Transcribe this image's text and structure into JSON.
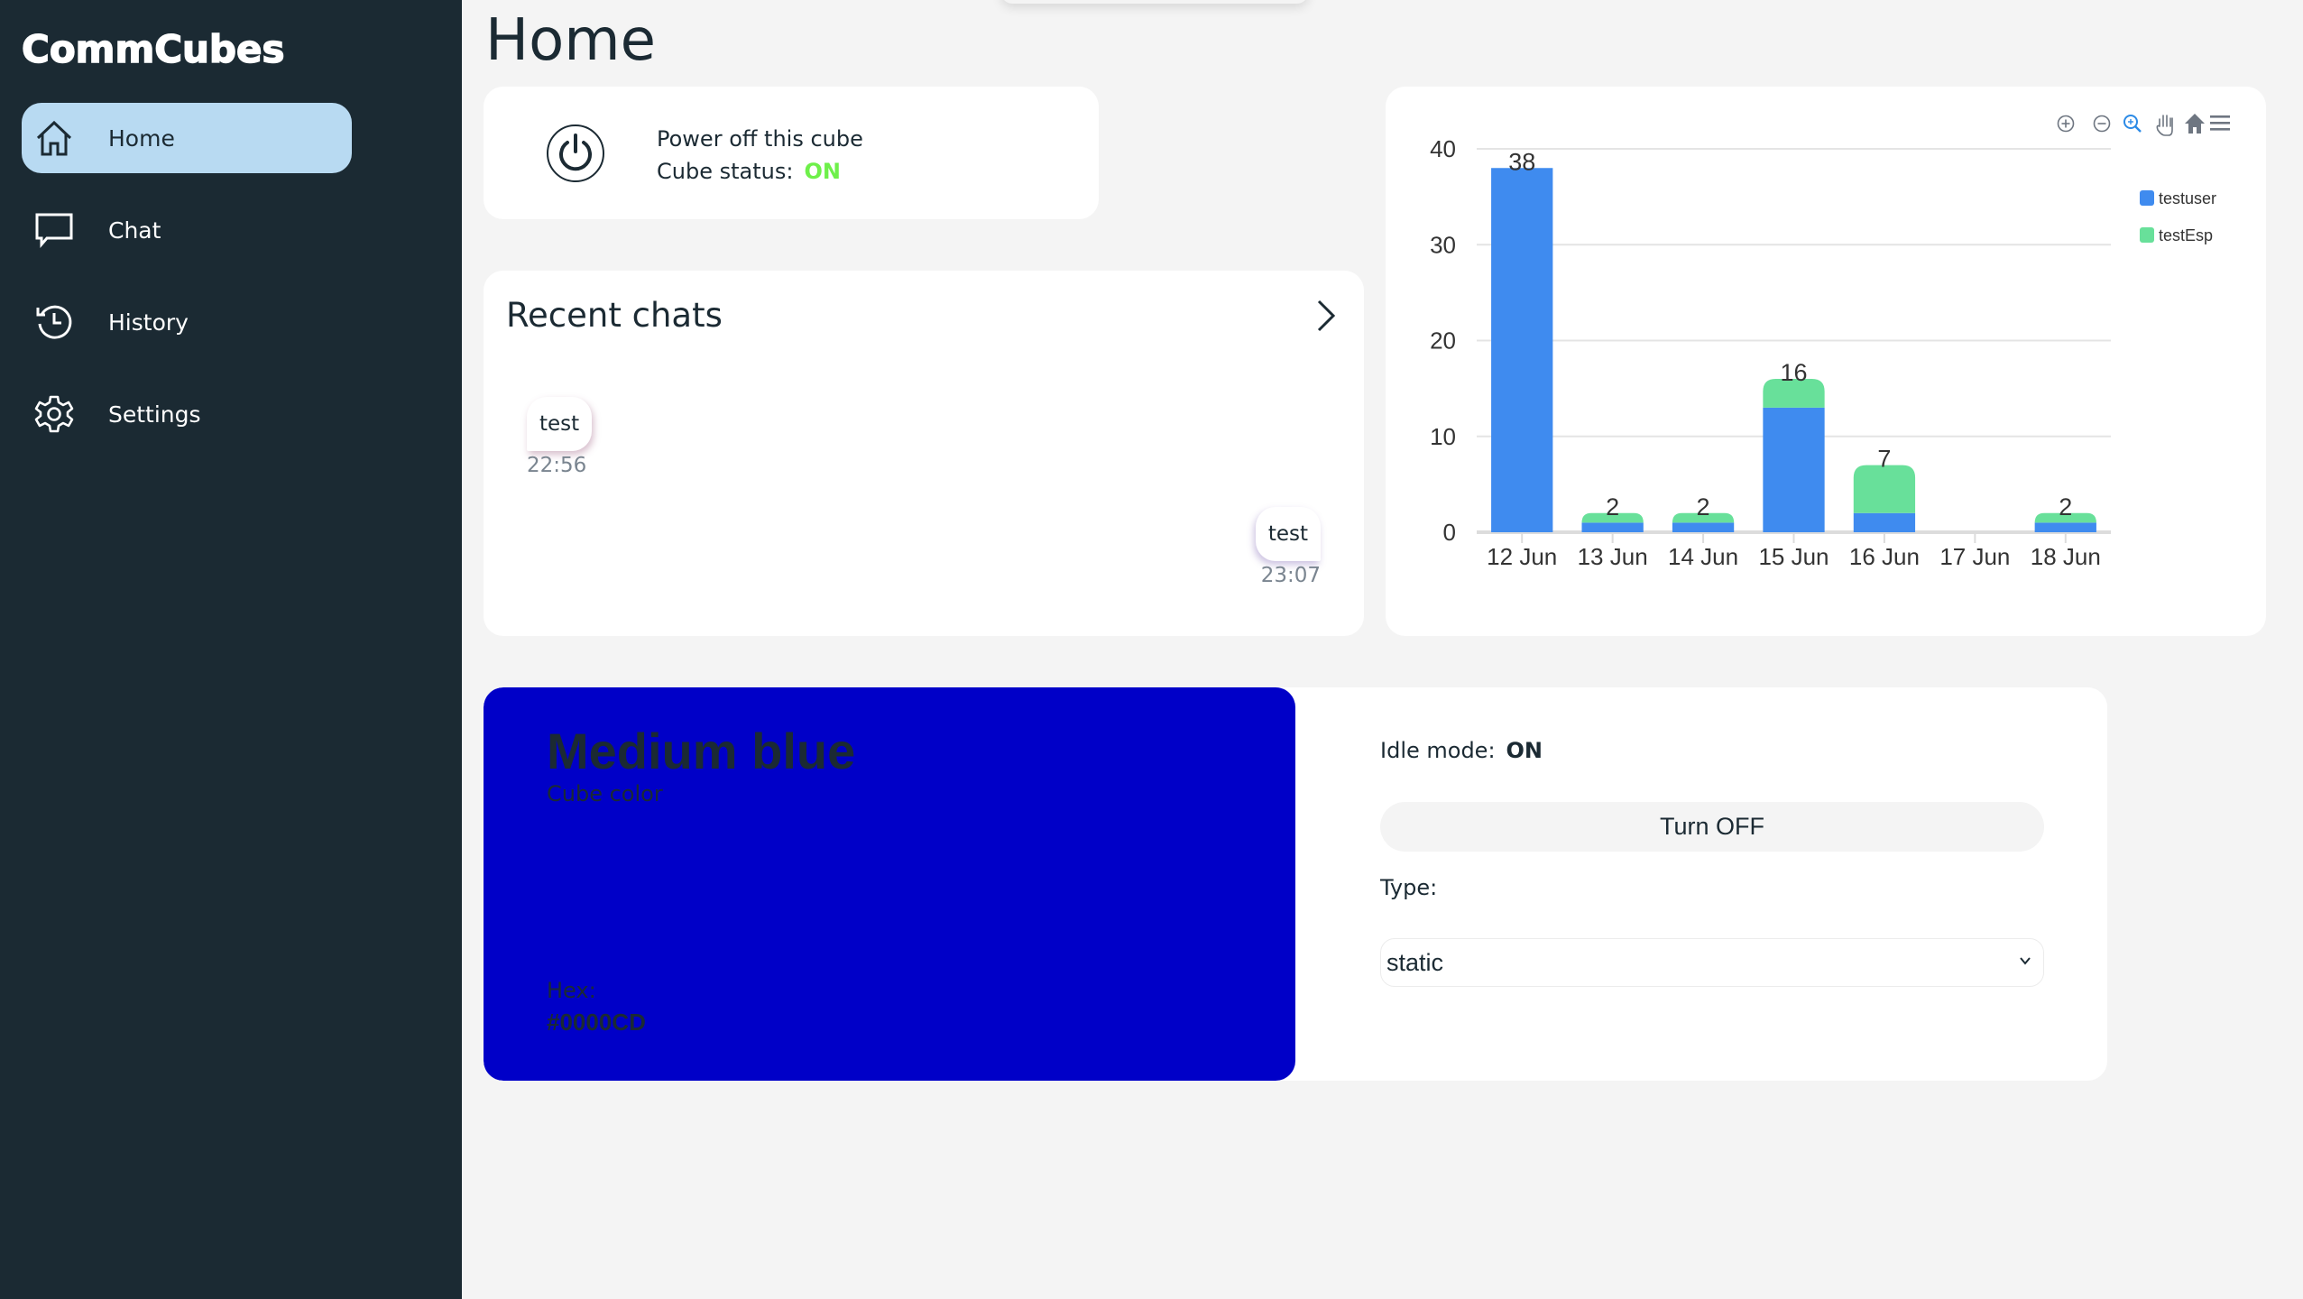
{
  "app": {
    "name": "CommCubes"
  },
  "sidebar": {
    "items": [
      {
        "label": "Home",
        "icon": "home-icon",
        "active": true
      },
      {
        "label": "Chat",
        "icon": "chat-icon",
        "active": false
      },
      {
        "label": "History",
        "icon": "history-icon",
        "active": false
      },
      {
        "label": "Settings",
        "icon": "gear-icon",
        "active": false
      }
    ]
  },
  "page": {
    "title": "Home"
  },
  "power_card": {
    "action_label": "Power off this cube",
    "status_label": "Cube status:",
    "status_value": "ON",
    "status_color": "#6ef04a"
  },
  "recent_chats": {
    "title": "Recent chats",
    "messages": [
      {
        "text": "test",
        "time": "22:56",
        "side": "left"
      },
      {
        "text": "test",
        "time": "23:07",
        "side": "right"
      }
    ]
  },
  "chart_toolbar": {
    "icons": [
      "zoom-in-icon",
      "zoom-out-icon",
      "selection-zoom-icon",
      "pan-icon",
      "reset-home-icon",
      "menu-icon"
    ]
  },
  "chart_data": {
    "type": "bar",
    "stacked": true,
    "title": "",
    "xlabel": "",
    "ylabel": "",
    "categories": [
      "12 Jun",
      "13 Jun",
      "14 Jun",
      "15 Jun",
      "16 Jun",
      "17 Jun",
      "18 Jun"
    ],
    "series": [
      {
        "name": "testuser",
        "color": "#3f8bef",
        "values": [
          38,
          1,
          1,
          13,
          2,
          0,
          1
        ]
      },
      {
        "name": "testEsp",
        "color": "#68e09a",
        "values": [
          0,
          1,
          1,
          3,
          5,
          0,
          1
        ]
      }
    ],
    "totals": [
      38,
      2,
      2,
      16,
      7,
      0,
      2
    ],
    "ylim": [
      0,
      40
    ],
    "yticks": [
      0,
      10,
      20,
      30,
      40
    ],
    "grid": true,
    "legend_position": "top-right"
  },
  "cube_color": {
    "name": "Medium blue",
    "subtitle": "Cube color",
    "hex_label": "Hex:",
    "hex": "#0000CD",
    "swatch_color": "#0000c8"
  },
  "idle": {
    "label": "Idle mode:",
    "value": "ON",
    "button_label": "Turn OFF",
    "type_label": "Type:",
    "type_selected": "static"
  }
}
